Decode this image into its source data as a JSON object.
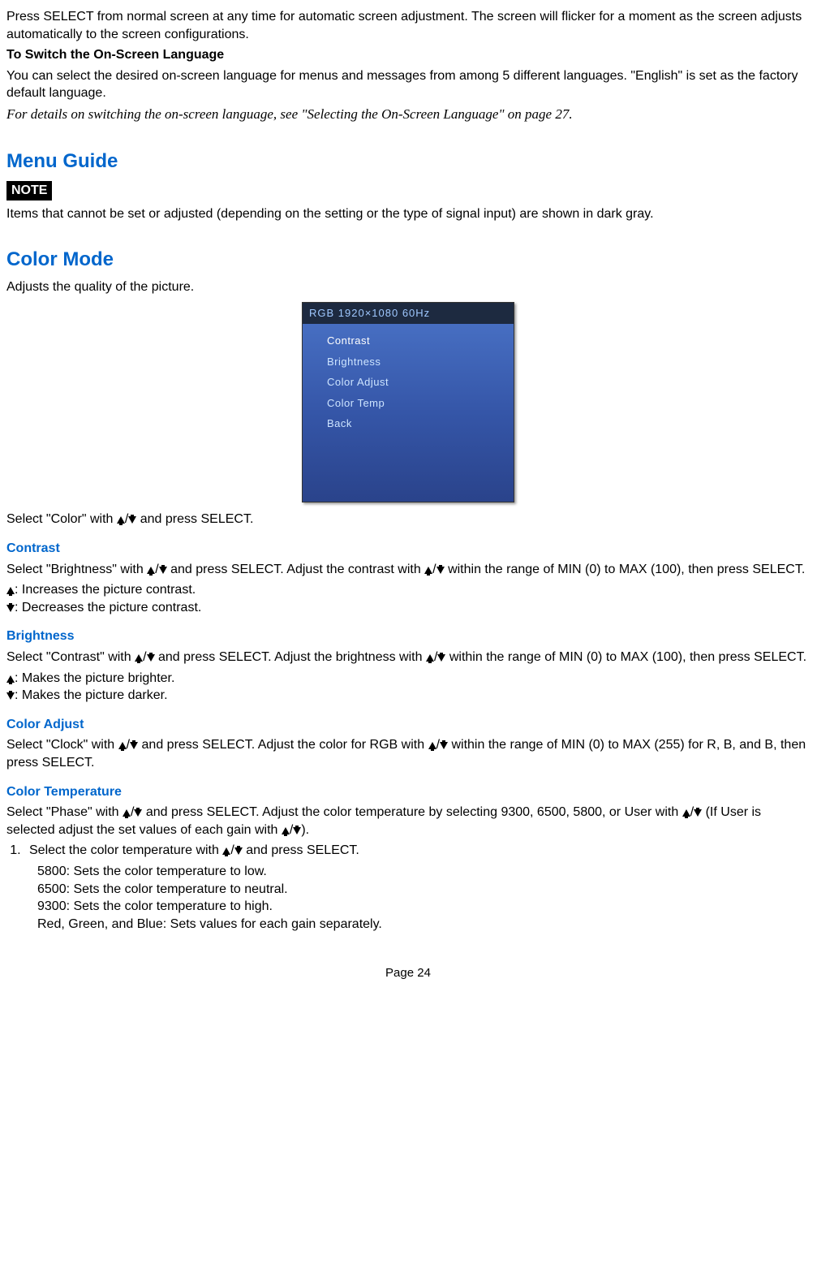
{
  "intro": {
    "p1": "Press SELECT from normal screen at any time for automatic screen adjustment. The screen will flicker for a moment as the screen adjusts automatically to the screen configurations."
  },
  "switchLang": {
    "heading": "To Switch the On-Screen Language",
    "p1": "You can select the desired on-screen language for menus and messages from among 5 different languages. \"English\" is set as the factory default language.",
    "p2": "For details on switching the on-screen language, see \"Selecting the On-Screen Language\" on page 27."
  },
  "menuGuide": {
    "heading": "Menu Guide",
    "noteLabel": "NOTE",
    "noteText": "Items that cannot be set or adjusted (depending on the setting or the type of signal input) are shown in dark gray."
  },
  "colorMode": {
    "heading": "Color Mode",
    "p1": "Adjusts the quality of the picture.",
    "osd": {
      "header": "RGB  1920×1080  60Hz",
      "items": [
        "Contrast",
        "Brightness",
        "Color Adjust",
        "Color Temp",
        "Back"
      ]
    },
    "p2a": "Select \"Color\" with ",
    "p2b": " and press SELECT."
  },
  "contrast": {
    "heading": "Contrast",
    "p1a": "Select \"Brightness\" with ",
    "p1b": " and press SELECT. Adjust the contrast with ",
    "p1c": " within the range of MIN (0) to MAX (100), then press SELECT.",
    "up": ": Increases the picture contrast.",
    "down": ": Decreases the picture contrast."
  },
  "brightness": {
    "heading": "Brightness",
    "p1a": "Select \"Contrast\" with ",
    "p1b": " and press SELECT. Adjust the brightness with ",
    "p1c": " within the range of MIN (0) to MAX (100), then press SELECT.",
    "up": ": Makes the picture brighter.",
    "down": ": Makes the picture darker."
  },
  "colorAdjust": {
    "heading": "Color Adjust",
    "p1a": "Select \"Clock\" with ",
    "p1b": " and press SELECT. Adjust the color for RGB with ",
    "p1c": " within the range of MIN (0) to MAX (255) for R, B, and B, then press SELECT."
  },
  "colorTemp": {
    "heading": "Color Temperature",
    "p1a": "Select \"Phase\" with ",
    "p1b": " and press SELECT. Adjust the color temperature by selecting 9300, 6500, 5800, or User with ",
    "p1c": " (If User is selected adjust the set values of each gain with ",
    "p1d": ").",
    "step1a": "Select the color temperature with ",
    "step1b": " and press SELECT.",
    "opt1": "5800: Sets the color temperature to low.",
    "opt2": "6500: Sets the color temperature to neutral.",
    "opt3": "9300: Sets the color temperature to high.",
    "opt4": "Red, Green, and Blue: Sets values for each gain separately."
  },
  "footer": "Page 24",
  "slash": "/"
}
